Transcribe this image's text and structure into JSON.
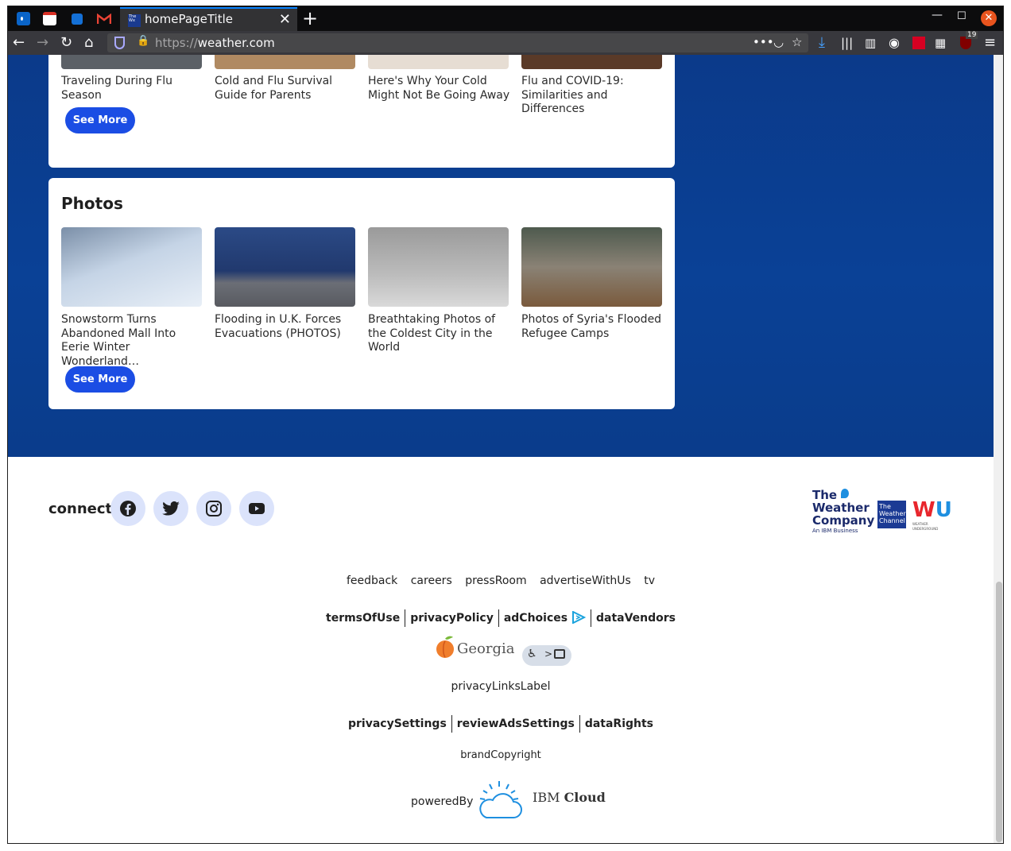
{
  "browser": {
    "tab_title": "homePageTitle",
    "url_scheme": "https://",
    "url_host": "weather.com",
    "addon_badge": "19"
  },
  "sections": {
    "top_captions": [
      "Traveling During Flu Season",
      "Cold and Flu Survival Guide for Parents",
      "Here's Why Your Cold Might Not Be Going Away",
      "Flu and COVID-19: Similarities and Differences"
    ],
    "top_see_more": "See More",
    "photos": {
      "title": "Photos",
      "captions": [
        "Snowstorm Turns Abandoned Mall Into Eerie Winter Wonderland…",
        "Flooding in U.K. Forces Evacuations (PHOTOS)",
        "Breathtaking Photos of the Coldest City in the World",
        "Photos of Syria's Flooded Refugee Camps"
      ],
      "see_more": "See More"
    }
  },
  "footer": {
    "connect_label": "connect",
    "social_icons": [
      "facebook-icon",
      "twitter-icon",
      "instagram-icon",
      "youtube-icon"
    ],
    "logos": {
      "twc_line1": "The",
      "twc_line2": "Weather",
      "twc_line3": "Company",
      "twc_sub": "An IBM Business",
      "channel_line1": "The",
      "channel_line2": "Weather",
      "channel_line3": "Channel",
      "wu_sub": "WEATHER UNDERGROUND"
    },
    "links_primary": [
      "feedback",
      "careers",
      "pressRoom",
      "advertiseWithUs",
      "tv"
    ],
    "links_legal": {
      "terms": "termsOfUse",
      "privacy": "privacyPolicy",
      "adchoices": "adChoices",
      "vendors": "dataVendors"
    },
    "georgia_label": "Georgia",
    "privacy_links_label": "privacyLinksLabel",
    "links_privacy": {
      "settings": "privacySettings",
      "review_ads": "reviewAdsSettings",
      "rights": "dataRights"
    },
    "copyright": "brandCopyright",
    "powered_by": "poweredBy",
    "ibm_cloud_a": "IBM",
    "ibm_cloud_b": "Cloud"
  },
  "colors": {
    "hero_blue": "#0b3a8a",
    "button_blue": "#1b4de4",
    "social_bg": "#dbe3fb"
  }
}
